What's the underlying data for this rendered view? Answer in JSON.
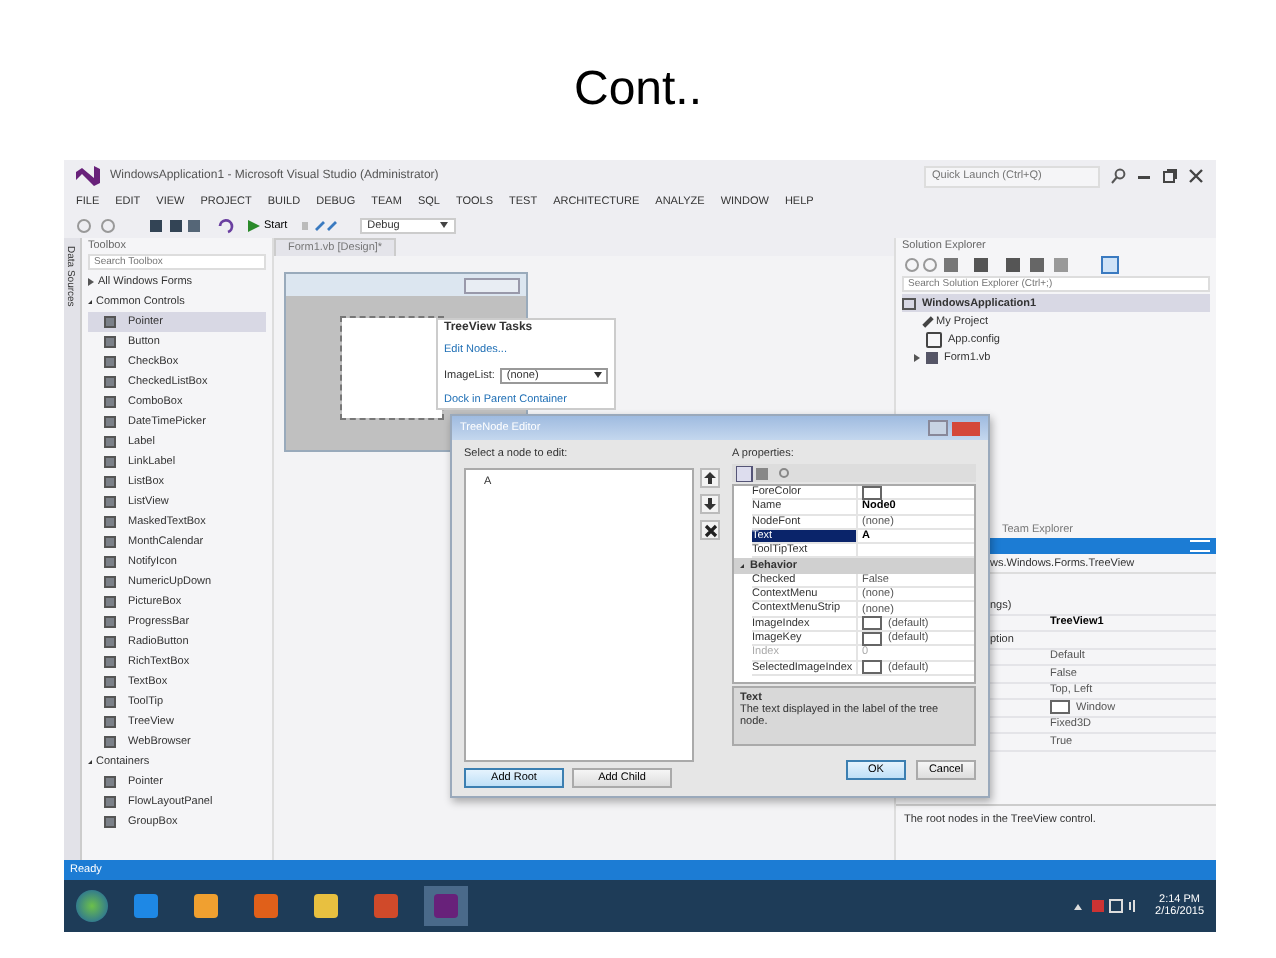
{
  "slide": {
    "title": "Cont.."
  },
  "window": {
    "title": "WindowsApplication1 - Microsoft Visual Studio (Administrator)",
    "quick_launch": {
      "placeholder": "Quick Launch (Ctrl+Q)"
    }
  },
  "menu": [
    "FILE",
    "EDIT",
    "VIEW",
    "PROJECT",
    "BUILD",
    "DEBUG",
    "TEAM",
    "SQL",
    "TOOLS",
    "TEST",
    "ARCHITECTURE",
    "ANALYZE",
    "WINDOW",
    "HELP"
  ],
  "toolbar": {
    "start": "Start",
    "configuration": "Debug"
  },
  "side_tab": "Data Sources",
  "toolbox": {
    "title": "Toolbox",
    "search": {
      "placeholder": "Search Toolbox"
    },
    "groups": [
      {
        "label": "All Windows Forms",
        "expanded": false
      },
      {
        "label": "Common Controls",
        "expanded": true,
        "items": [
          {
            "label": "Pointer",
            "selected": true
          },
          {
            "label": "Button",
            "selected": false
          },
          {
            "label": "CheckBox",
            "selected": false
          },
          {
            "label": "CheckedListBox",
            "selected": false
          },
          {
            "label": "ComboBox",
            "selected": false
          },
          {
            "label": "DateTimePicker",
            "selected": false
          },
          {
            "label": "Label",
            "selected": false
          },
          {
            "label": "LinkLabel",
            "selected": false
          },
          {
            "label": "ListBox",
            "selected": false
          },
          {
            "label": "ListView",
            "selected": false
          },
          {
            "label": "MaskedTextBox",
            "selected": false
          },
          {
            "label": "MonthCalendar",
            "selected": false
          },
          {
            "label": "NotifyIcon",
            "selected": false
          },
          {
            "label": "NumericUpDown",
            "selected": false
          },
          {
            "label": "PictureBox",
            "selected": false
          },
          {
            "label": "ProgressBar",
            "selected": false
          },
          {
            "label": "RadioButton",
            "selected": false
          },
          {
            "label": "RichTextBox",
            "selected": false
          },
          {
            "label": "TextBox",
            "selected": false
          },
          {
            "label": "ToolTip",
            "selected": false
          },
          {
            "label": "TreeView",
            "selected": false
          },
          {
            "label": "WebBrowser",
            "selected": false
          }
        ]
      },
      {
        "label": "Containers",
        "expanded": true,
        "items": [
          {
            "label": "Pointer",
            "selected": false
          },
          {
            "label": "FlowLayoutPanel",
            "selected": false
          },
          {
            "label": "GroupBox",
            "selected": false
          }
        ]
      }
    ]
  },
  "designer_tab": {
    "label": "Form1.vb [Design]*"
  },
  "tasks": {
    "title": "TreeView Tasks",
    "edit_nodes": "Edit Nodes...",
    "imagelist_label": "ImageList:",
    "imagelist_value": "(none)",
    "dock": "Dock in Parent Container"
  },
  "dialog": {
    "title": "TreeNode Editor",
    "select_label": "Select a node to edit:",
    "nodes": [
      {
        "label": "A",
        "selected": false
      }
    ],
    "add_root": "Add Root",
    "add_child": "Add Child",
    "props_label": "A properties:",
    "properties": [
      {
        "kind": "row",
        "name": "ForeColor",
        "swatch": true,
        "disabled": false,
        "selected": false
      },
      {
        "kind": "row",
        "name": "Name",
        "value": "Node0",
        "swatch": false,
        "bold": true,
        "disabled": false,
        "selected": false
      },
      {
        "kind": "row",
        "name": "NodeFont",
        "value": "(none)",
        "swatch": false,
        "bold": false,
        "disabled": false,
        "selected": false
      },
      {
        "kind": "row",
        "name": "Text",
        "value": "A",
        "swatch": false,
        "bold": true,
        "disabled": false,
        "selected": true
      },
      {
        "kind": "row",
        "name": "ToolTipText",
        "swatch": false,
        "disabled": false,
        "selected": false
      },
      {
        "kind": "category",
        "name": "Behavior",
        "expanded": true
      },
      {
        "kind": "row",
        "name": "Checked",
        "value": "False",
        "swatch": false,
        "bold": false,
        "disabled": false,
        "selected": false
      },
      {
        "kind": "row",
        "name": "ContextMenu",
        "value": "(none)",
        "swatch": false,
        "bold": false,
        "disabled": false,
        "selected": false
      },
      {
        "kind": "row",
        "name": "ContextMenuStrip",
        "value": "(none)",
        "swatch": false,
        "bold": false,
        "disabled": false,
        "selected": false
      },
      {
        "kind": "row",
        "name": "ImageIndex",
        "value": "(default)",
        "swatch": true,
        "bold": false,
        "disabled": false,
        "selected": false
      },
      {
        "kind": "row",
        "name": "ImageKey",
        "value": "(default)",
        "swatch": true,
        "bold": false,
        "disabled": false,
        "selected": false
      },
      {
        "kind": "row",
        "name": "Index",
        "value": "0",
        "swatch": false,
        "bold": false,
        "disabled": true,
        "selected": false
      },
      {
        "kind": "row",
        "name": "SelectedImageIndex",
        "value": "(default)",
        "swatch": true,
        "bold": false,
        "disabled": false,
        "selected": false
      }
    ],
    "desc_title": "Text",
    "desc": "The text displayed in the label of the tree node.",
    "ok": "OK",
    "cancel": "Cancel"
  },
  "solution_explorer": {
    "title": "Solution Explorer",
    "search": {
      "placeholder": "Search Solution Explorer (Ctrl+;)"
    },
    "tree": [
      {
        "label": "WindowsApplication1",
        "kind": "solution",
        "selected": true,
        "children": [
          {
            "label": "My Project",
            "kind": "project",
            "selected": false
          },
          {
            "label": "App.config",
            "kind": "config",
            "selected": false
          },
          {
            "label": "Form1.vb",
            "kind": "form",
            "selected": false,
            "expanded": false
          }
        ]
      }
    ]
  },
  "team_explorer": "Team Explorer",
  "properties": {
    "object": "ws.Windows.Forms.TreeView",
    "rows": [
      {
        "name": "ngs)",
        "swatch": false
      },
      {
        "value": "TreeView1",
        "bold": true,
        "swatch": false
      },
      {
        "name": "ption",
        "swatch": false
      },
      {
        "value": "Default",
        "bold": false,
        "swatch": false
      },
      {
        "value": "False",
        "bold": false,
        "swatch": false
      },
      {
        "value": "Top, Left",
        "bold": false,
        "swatch": false
      },
      {
        "value": "Window",
        "bold": false,
        "swatch": true
      },
      {
        "value": "Fixed3D",
        "bold": false,
        "swatch": false
      },
      {
        "value": "True",
        "bold": false,
        "swatch": false
      }
    ],
    "description": "The root nodes in the TreeView control."
  },
  "status": "Ready",
  "taskbar": {
    "apps": [
      {
        "kind": "browser"
      },
      {
        "kind": "media"
      },
      {
        "kind": "firefox"
      },
      {
        "kind": "folder"
      },
      {
        "kind": "slides"
      },
      {
        "kind": "studio"
      }
    ],
    "time": "2:14 PM",
    "date": "2/16/2015"
  }
}
